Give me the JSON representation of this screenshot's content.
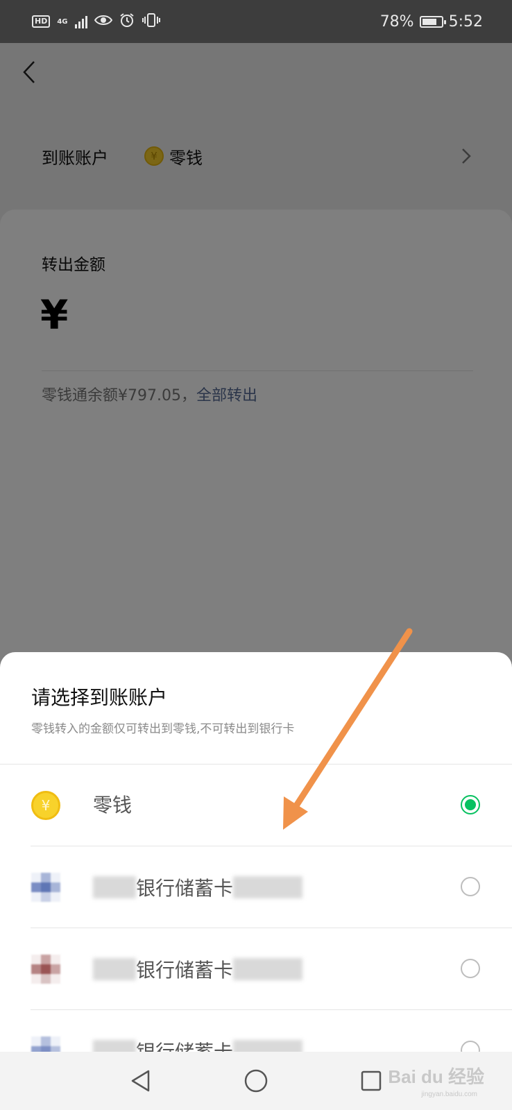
{
  "status_bar": {
    "hd": "HD",
    "network": "4G",
    "battery_text": "78%",
    "battery_level": 0.78,
    "time": "5:52"
  },
  "page": {
    "account_label": "到账账户",
    "account_value": "零钱",
    "amount_title": "转出金额",
    "currency_symbol": "¥",
    "balance_text": "零钱通余额¥797.05，",
    "withdraw_all": "全部转出"
  },
  "sheet": {
    "title": "请选择到账账户",
    "subtitle": "零钱转入的金额仅可转出到零钱,不可转出到银行卡",
    "options": [
      {
        "label": "零钱",
        "icon": "coin-icon",
        "selected": true
      },
      {
        "label": "银行储蓄卡",
        "icon": "bank-logo-icon",
        "selected": false
      },
      {
        "label": "银行储蓄卡",
        "icon": "bank-logo-icon",
        "selected": false
      },
      {
        "label": "银行储蓄卡",
        "icon": "bank-logo-icon",
        "selected": false
      }
    ]
  },
  "nav": {
    "icons": [
      "back-triangle-icon",
      "home-circle-icon",
      "recents-square-icon"
    ]
  },
  "watermark": {
    "text": "Bai du 经验",
    "sub": "jingyan.baidu.com"
  },
  "colors": {
    "accent_green": "#07c160",
    "link_blue": "#576b95",
    "coin_yellow": "#f8d22b",
    "annotation_arrow": "#f0924a"
  }
}
